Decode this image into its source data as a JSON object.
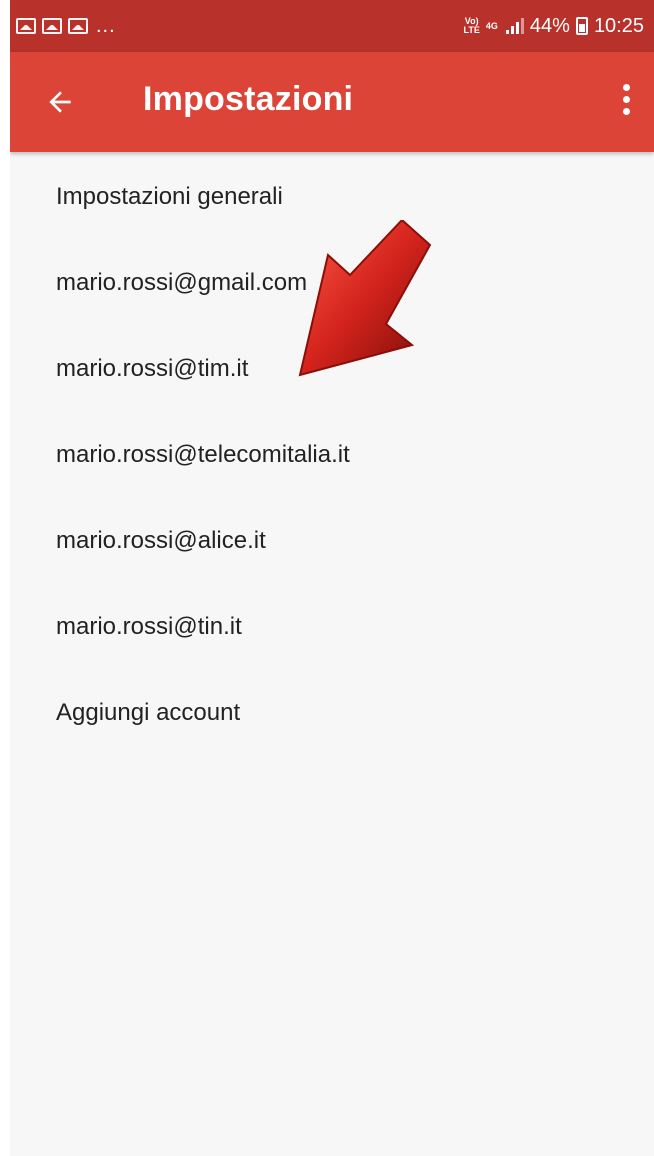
{
  "statusbar": {
    "notification_icons": [
      "image-icon",
      "mail-icon",
      "mail-icon"
    ],
    "more": "...",
    "volte": "Vo)\nLTE",
    "network": "4G",
    "battery_percent": "44%",
    "time": "10:25"
  },
  "appbar": {
    "title": "Impostazioni",
    "back_icon": "arrow-back-icon",
    "menu_icon": "more-vert-icon",
    "color": "#db4437"
  },
  "settings_list": [
    {
      "label": "Impostazioni generali"
    },
    {
      "label": "mario.rossi@gmail.com"
    },
    {
      "label": "mario.rossi@tim.it"
    },
    {
      "label": "mario.rossi@telecomitalia.it"
    },
    {
      "label": "mario.rossi@alice.it"
    },
    {
      "label": "mario.rossi@tin.it"
    },
    {
      "label": "Aggiungi account"
    }
  ],
  "overlay": {
    "arrow_color": "#d3231c"
  }
}
